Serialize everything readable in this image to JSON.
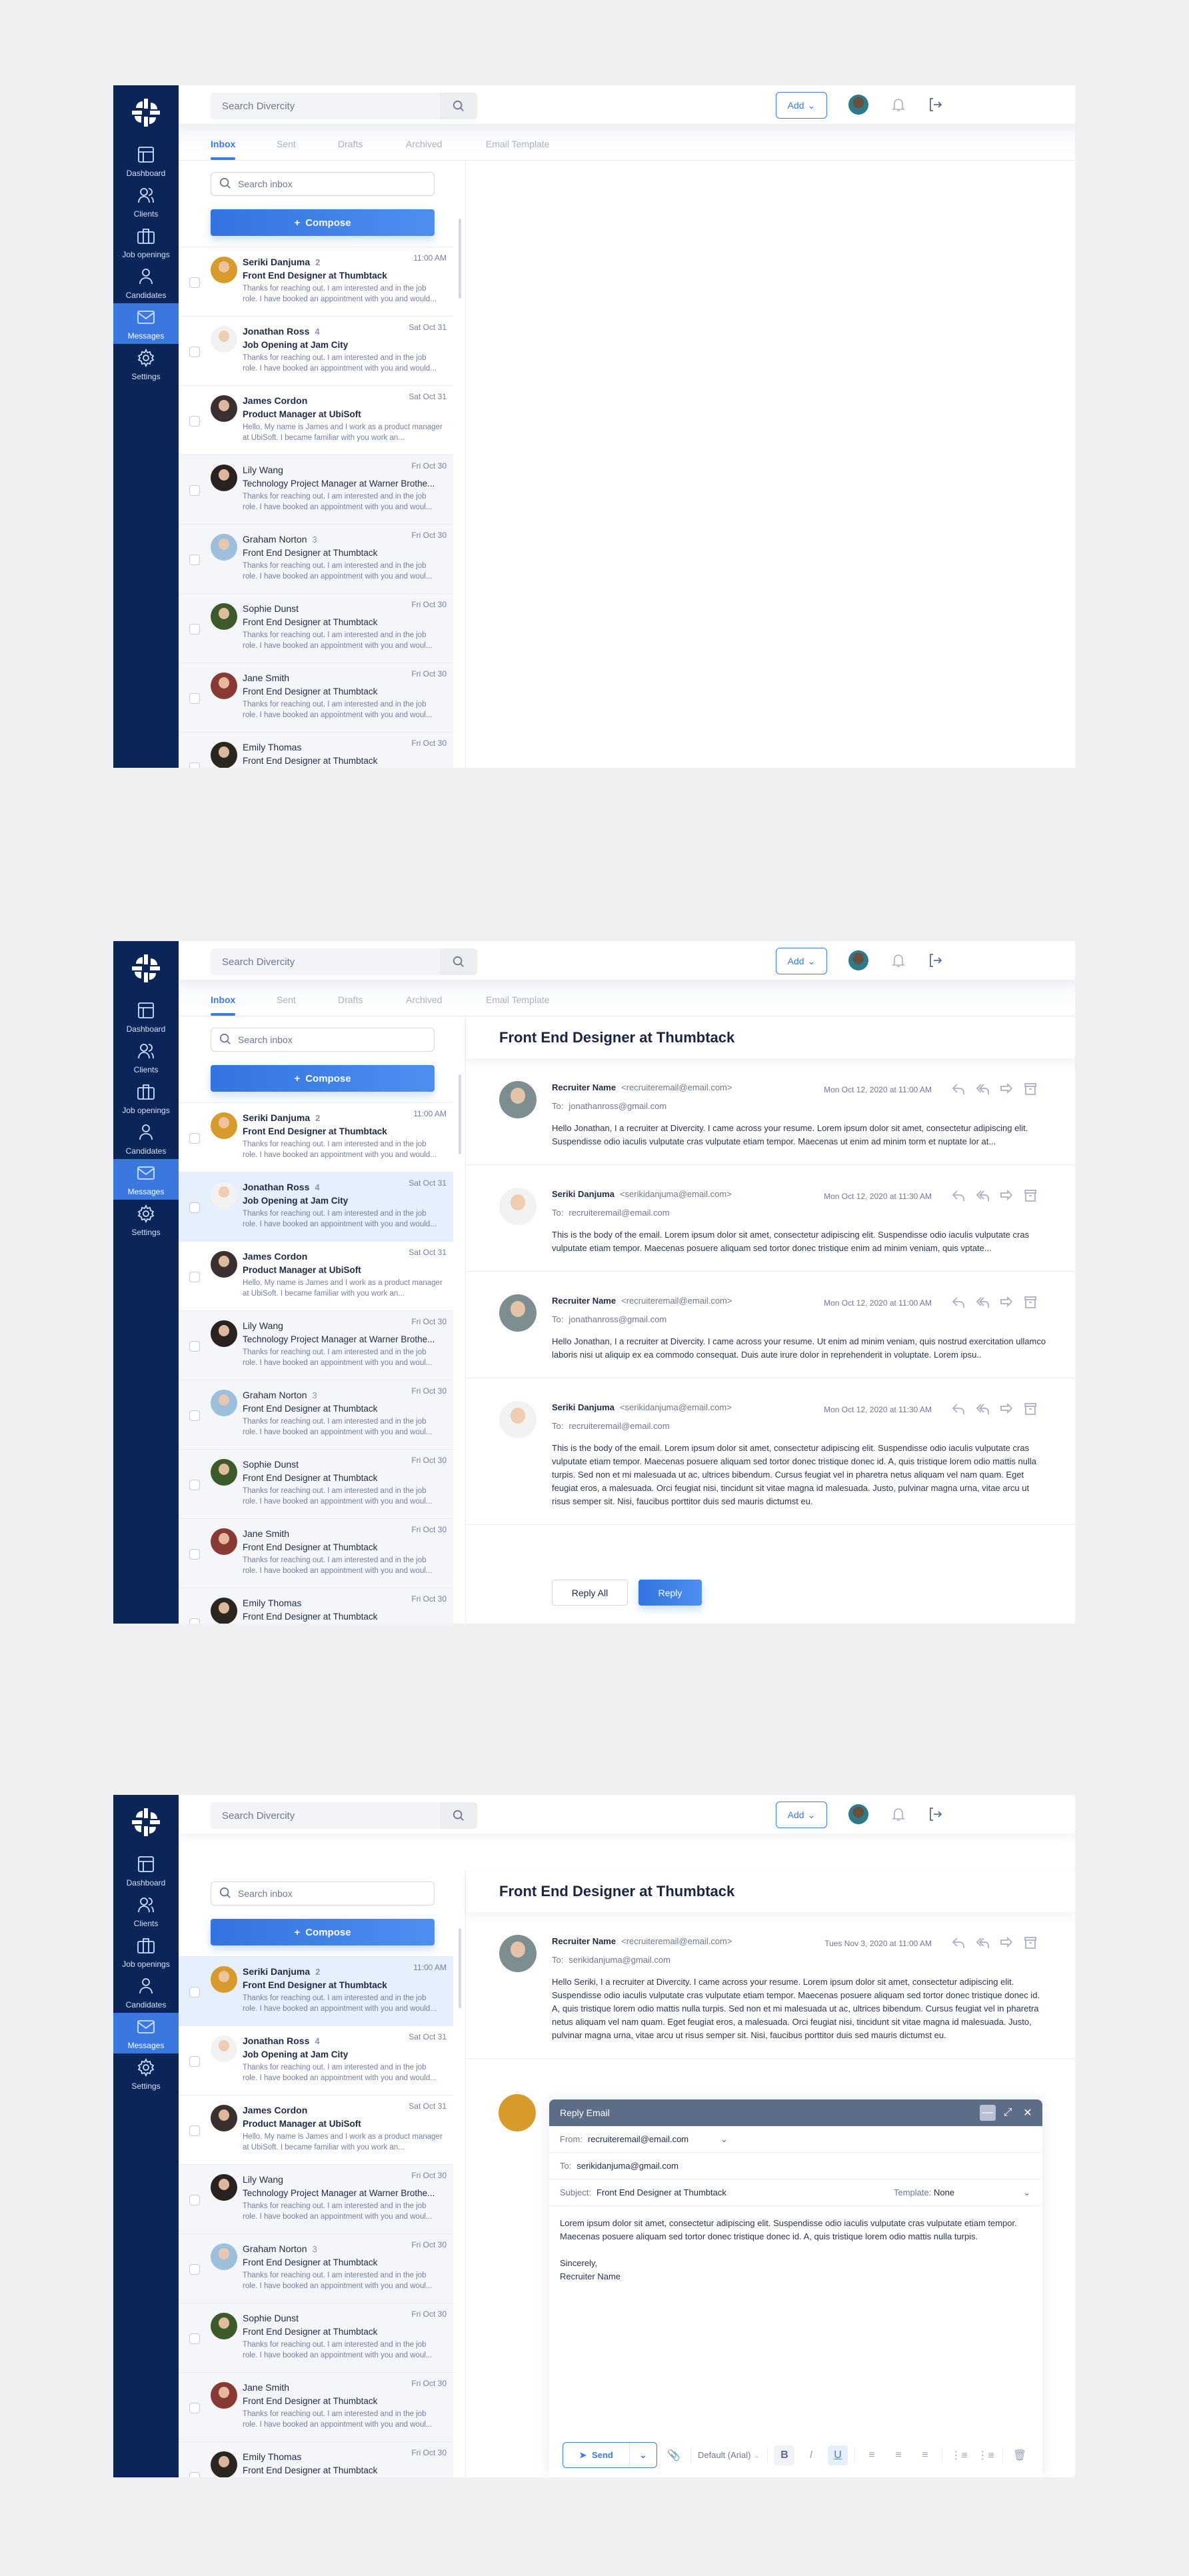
{
  "app": {
    "search_placeholder": "Search Divercity",
    "add_label": "Add",
    "nav": [
      {
        "label": "Dashboard",
        "icon": "dashboard-icon"
      },
      {
        "label": "Clients",
        "icon": "clients-icon"
      },
      {
        "label": "Job openings",
        "icon": "briefcase-icon"
      },
      {
        "label": "Candidates",
        "icon": "candidate-icon"
      },
      {
        "label": "Messages",
        "icon": "mail-icon"
      },
      {
        "label": "Settings",
        "icon": "gear-icon"
      }
    ],
    "active_nav": 4,
    "tabs": [
      "Inbox",
      "Sent",
      "Drafts",
      "Archived",
      "Email Template"
    ],
    "active_tab": 0,
    "inbox_search_placeholder": "Search inbox",
    "compose_label": "Compose",
    "colors": {
      "sidebar": "#0b2558",
      "accent": "#3b7be6",
      "active_nav": "#3a78e0",
      "selected_row": "#e6f0fc"
    }
  },
  "conversations": [
    {
      "name": "Seriki Danjuma",
      "count": "2",
      "subject": "Front End Designer at Thumbtack",
      "preview": "Thanks for reaching out. I am interested and in the job role. I have booked an appointment with you and would...",
      "date": "11:00 AM",
      "unread": true,
      "avatar_color": "#d89a2a"
    },
    {
      "name": "Jonathan Ross",
      "count": "4",
      "subject": "Job Opening at Jam City",
      "preview": "Thanks for reaching out. I am interested and in the job role. I have booked an appointment with you and would...",
      "date": "Sat Oct 31",
      "unread": true,
      "avatar_color": "#f2f2f2"
    },
    {
      "name": "James Cordon",
      "count": "",
      "subject": "Product Manager at UbiSoft",
      "preview": "Hello, My name is James and I work as a product manager at UbiSoft. I became familiar with you work an...",
      "date": "Sat Oct 31",
      "unread": true,
      "avatar_color": "#3a3030"
    },
    {
      "name": "Lily Wang",
      "count": "",
      "subject": "Technology Project Manager at Warner Brothe...",
      "preview": "Thanks for reaching out. I am interested and in the job role. I have booked an appointment with you and woul...",
      "date": "Fri Oct 30",
      "unread": false,
      "avatar_color": "#2a2220"
    },
    {
      "name": "Graham Norton",
      "count": "3",
      "subject": "Front End Designer at Thumbtack",
      "preview": "Thanks for reaching out. I am interested and in the job role. I have booked an appointment with you and woul...",
      "date": "Fri Oct 30",
      "unread": false,
      "avatar_color": "#9cc0dc"
    },
    {
      "name": "Sophie Dunst",
      "count": "",
      "subject": "Front End Designer at Thumbtack",
      "preview": "Thanks for reaching out. I am interested and in the job role. I have booked an appointment with you and woul...",
      "date": "Fri Oct 30",
      "unread": false,
      "avatar_color": "#3d5a2a"
    },
    {
      "name": "Jane Smith",
      "count": "",
      "subject": "Front End Designer at Thumbtack",
      "preview": "Thanks for reaching out. I am interested and in the job role. I have booked an appointment with you and woul...",
      "date": "Fri Oct 30",
      "unread": false,
      "avatar_color": "#8a3a34"
    },
    {
      "name": "Emily Thomas",
      "count": "",
      "subject": "Front End Designer at Thumbtack",
      "preview": "",
      "date": "Fri Oct 30",
      "unread": false,
      "avatar_color": "#2b2620"
    }
  ],
  "screens": [
    {
      "show_tabs": true,
      "selected": -1
    },
    {
      "show_tabs": true,
      "selected": 1,
      "thread": {
        "title": "Front End Designer at Thumbtack",
        "to_label": "To:",
        "messages": [
          {
            "name": "Recruiter Name",
            "email": "<recruiteremail@email.com>",
            "to": "jonathanross@gmail.com",
            "date": "Mon Oct 12, 2020 at 11:00 AM",
            "avatar_color": "#7c8e90",
            "body": "Hello Jonathan, I a recruiter at Divercity. I came across your resume. Lorem ipsum dolor sit amet, consectetur adipiscing elit. Suspendisse odio iaculis vulputate cras vulputate etiam tempor. Maecenas ut enim ad minim torm et nuptate lor at..."
          },
          {
            "name": "Seriki Danjuma",
            "email": "<serikidanjuma@email.com>",
            "to": "recruiteremail@email.com",
            "date": "Mon Oct 12, 2020 at 11:30 AM",
            "avatar_color": "#f2f2f2",
            "body": "This is the body of the email. Lorem ipsum dolor sit amet, consectetur adipiscing elit. Suspendisse odio iaculis vulputate cras vulputate etiam tempor. Maecenas posuere aliquam sed tortor donec tristique enim ad minim veniam, quis vptate..."
          },
          {
            "name": "Recruiter Name",
            "email": "<recruiteremail@email.com>",
            "to": "jonathanross@gmail.com",
            "date": "Mon Oct 12, 2020 at 11:00 AM",
            "avatar_color": "#7c8e90",
            "body": "Hello Jonathan, I a recruiter at Divercity. I came across your resume. Ut enim ad minim veniam, quis nostrud exercitation ullamco laboris nisi ut aliquip ex ea commodo consequat. Duis aute irure dolor in reprehenderit in voluptate. Lorem ipsu.."
          },
          {
            "name": "Seriki Danjuma",
            "email": "<serikidanjuma@email.com>",
            "to": "recruiteremail@email.com",
            "date": "Mon Oct 12, 2020 at 11:30 AM",
            "avatar_color": "#f2f2f2",
            "body": "This is the body of the email. Lorem ipsum dolor sit amet, consectetur adipiscing elit. Suspendisse odio iaculis vulputate cras vulputate etiam tempor. Maecenas posuere aliquam sed tortor donec tristique donec id. A, quis tristique lorem odio mattis nulla turpis. Sed non et mi malesuada ut ac, ultrices bibendum. Cursus feugiat vel in pharetra netus aliquam vel nam quam. Eget feugiat eros, a malesuada. Orci feugiat nisi, tincidunt sit vitae magna id malesuada. Justo, pulvinar magna urna, vitae arcu ut risus semper sit. Nisi, faucibus porttitor duis sed mauris dictumst eu."
          }
        ],
        "reply_all_label": "Reply All",
        "reply_label": "Reply"
      }
    },
    {
      "show_tabs": false,
      "selected": 0,
      "thread": {
        "title": "Front End Designer at Thumbtack",
        "to_label": "To:",
        "messages": [
          {
            "name": "Recruiter Name",
            "email": "<recruiteremail@email.com>",
            "to": "serikidanjuma@gmail.com",
            "date": "Tues Nov 3, 2020 at 11:00 AM",
            "avatar_color": "#7c8e90",
            "body": "Hello Seriki, I a recruiter at Divercity. I came across your resume. Lorem ipsum dolor sit amet, consectetur adipiscing elit. Suspendisse odio iaculis vulputate cras vulputate etiam tempor. Maecenas posuere aliquam sed tortor donec tristique donec id. A, quis tristique lorem odio mattis nulla turpis. Sed non et mi malesuada ut ac, ultrices bibendum. Cursus feugiat vel in pharetra netus aliquam vel nam quam. Eget feugiat eros, a malesuada. Orci feugiat nisi, tincidunt sit vitae magna id malesuada. Justo, pulvinar magna urna, vitae arcu ut risus semper sit. Nisi, faucibus porttitor duis sed mauris dictumst eu."
          }
        ]
      },
      "reply": {
        "title": "Reply Email",
        "from_label": "From:",
        "from": "recruiteremail@email.com",
        "to_label": "To:",
        "to": "serikidanjuma@gmail.com",
        "subject_label": "Subject:",
        "subject": "Front End Designer at Thumbtack",
        "template_label": "Template:",
        "template": "None",
        "body": "Lorem ipsum dolor sit amet, consectetur adipiscing elit. Suspendisse odio iaculis vulputate cras vulputate etiam tempor. Maecenas posuere aliquam sed tortor donec tristique donec id. A, quis tristique lorem odio mattis nulla turpis.",
        "closing": "Sincerely,",
        "signature": "Recruiter Name",
        "send_label": "Send",
        "font": "Default (Arial)",
        "bold_active": false,
        "underline_active": true
      }
    }
  ]
}
